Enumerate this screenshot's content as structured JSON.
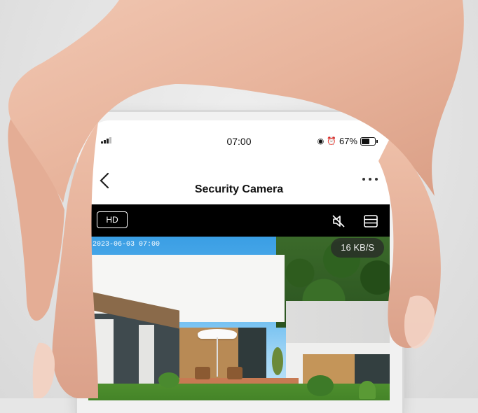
{
  "status_bar": {
    "time": "07:00",
    "battery_percent": "67%",
    "battery_level": 0.67,
    "icons": [
      "signal-icon",
      "location-icon",
      "alarm-icon",
      "battery-icon"
    ]
  },
  "header": {
    "title": "Security Camera",
    "back_icon": "chevron-left-icon",
    "more_icon": "more-horizontal-icon"
  },
  "video_toolbar": {
    "quality_label": "HD",
    "icons": [
      "speaker-muted-icon",
      "menu-list-icon"
    ]
  },
  "video": {
    "timestamp": "2023-06-03 07:00",
    "bitrate": "16 KB/S"
  },
  "colors": {
    "toolbar_bg": "#000000",
    "skin": "#e9b9a2"
  }
}
